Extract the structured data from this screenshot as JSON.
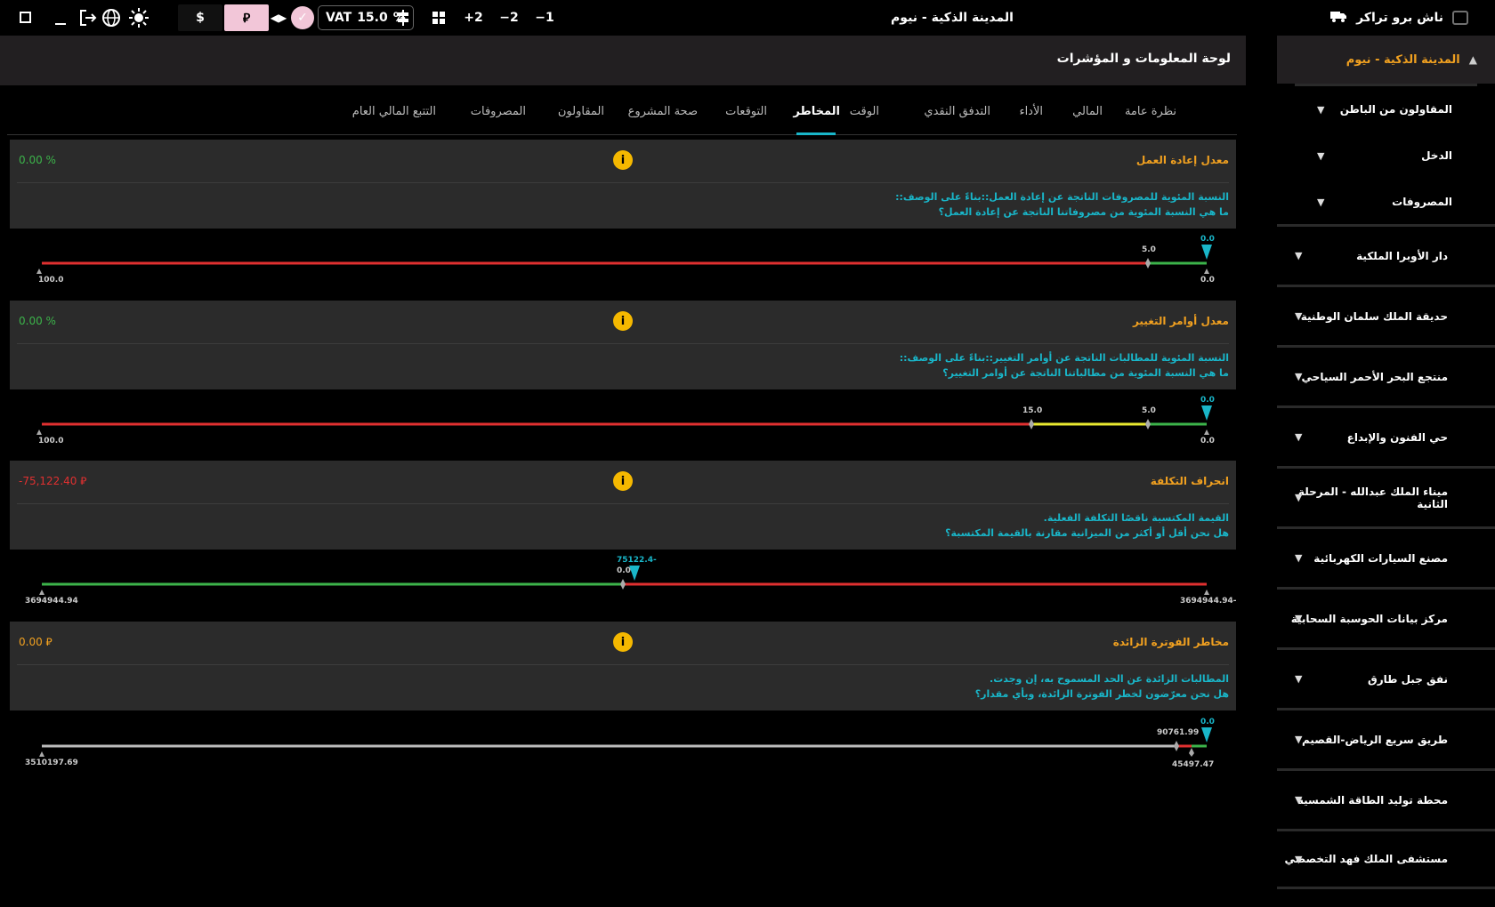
{
  "topbar": {
    "app_name": "ناش برو تراكر",
    "project_title": "المدينة الذكية - نيوم",
    "minus1": "−1",
    "minus2": "−2",
    "plus2": "+2",
    "vat_label": "VAT",
    "vat_value": "15.0",
    "vat_unit": "%",
    "currency_riyal": "⃁",
    "currency_dollar": "$"
  },
  "sidebar": {
    "project": "المدينة الذكية - نيوم",
    "sub_items": [
      "المقاولون من الباطن",
      "الدخل",
      "المصروفات"
    ],
    "items": [
      "دار الأوبرا الملكية",
      "حديقة الملك سلمان الوطنية",
      "منتجع البحر الأحمر السياحي",
      "حي الفنون والإبداع",
      "ميناء الملك عبدالله - المرحلة الثانية",
      "مصنع السيارات الكهربائية",
      "مركز بيانات الحوسبة السحابية",
      "نفق جبل طارق",
      "طريق سريع الرياض-القصيم",
      "محطة توليد الطاقة الشمسية",
      "مستشفى الملك فهد التخصصي"
    ]
  },
  "main": {
    "title": "لوحة المعلومات و المؤشرات",
    "tabs": [
      "نظرة عامة",
      "المالي",
      "الأداء",
      "التدفق النقدي",
      "الوقت",
      "المخاطر",
      "التوقعات",
      "صحة المشروع",
      "المقاولون",
      "المصروفات",
      "التتبع المالي العام"
    ],
    "active_tab": "المخاطر"
  },
  "cards": [
    {
      "title": "معدل إعادة العمل",
      "value": "0.00 %",
      "desc1": "النسبة المئوية للمصروفات الناتجة عن إعادة العمل::بناءً على الوصف::",
      "desc2": "ما هي النسبة المئوية من مصروفاتنا الناتجة عن إعادة العمل؟",
      "gauge": {
        "min_label": "100.0",
        "max_label": "0.0",
        "marks": [
          "5.0"
        ],
        "pointer": "0.0"
      }
    },
    {
      "title": "معدل أوامر التغيير",
      "value": "0.00 %",
      "desc1": "النسبة المئوية للمطالبات الناتجة عن أوامر التغيير::بناءً على الوصف::",
      "desc2": "ما هي النسبة المئوية من مطالباتنا الناتجة عن أوامر التغيير؟",
      "gauge": {
        "min_label": "100.0",
        "max_label": "0.0",
        "marks": [
          "15.0",
          "5.0"
        ],
        "pointer": "0.0"
      }
    },
    {
      "title": "انحراف التكلفة",
      "value": "-75,122.40 ⃁",
      "desc1": "القيمة المكتسبة ناقصًا التكلفة الفعلية.",
      "desc2": "هل نحن أقل أو أكثر من الميزانية مقارنة بالقيمة المكتسبة؟",
      "gauge": {
        "min_label": "3694944.94",
        "max_label": "-3694944.94",
        "marks": [
          "0.0"
        ],
        "pointer": "-75122.4"
      }
    },
    {
      "title": "مخاطر الفوترة الزائدة",
      "value": "0.00 ⃁",
      "desc1": "المطالبات الزائدة عن الحد المسموح به، إن وجدت.",
      "desc2": "هل نحن معرّضون لخطر الفوترة الزائدة، وبأي مقدار؟",
      "gauge": {
        "min_label": "3510197.69",
        "max_label": "",
        "marks": [
          "90761.99",
          "45497.47"
        ],
        "pointer": "0.0"
      }
    }
  ],
  "colors": {
    "accent": "#19b6c9",
    "title_orange": "#f0a020",
    "good": "#3cb34a",
    "bad": "#e03030",
    "warn": "#e8e830",
    "pink": "#f2c6d8"
  }
}
